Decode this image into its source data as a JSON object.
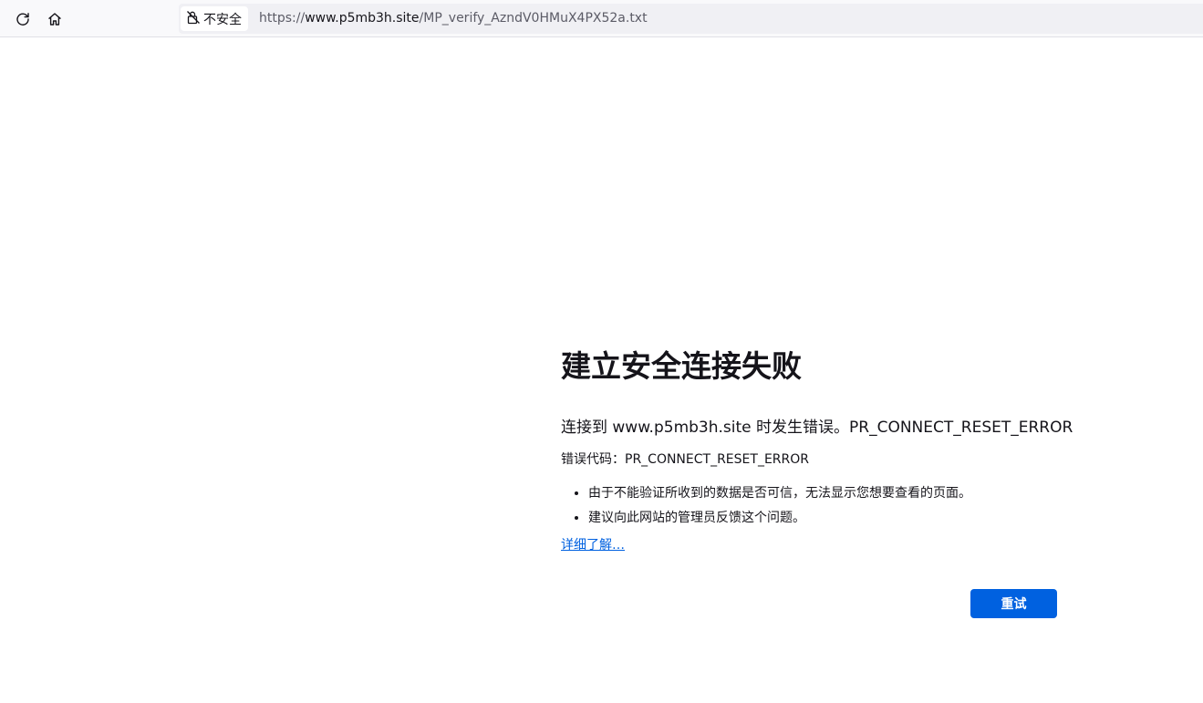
{
  "toolbar": {
    "reload_icon": "reload-icon",
    "home_icon": "home-icon"
  },
  "urlbar": {
    "security_icon": "lock-warning-icon",
    "security_label": "不安全",
    "url_scheme": "https://",
    "url_host": "www.p5mb3h.site",
    "url_path": "/MP_verify_AzndV0HMuX4PX52a.txt"
  },
  "error": {
    "title": "建立安全连接失败",
    "description": "连接到 www.p5mb3h.site 时发生错误。PR_CONNECT_RESET_ERROR",
    "code_line": "错误代码：PR_CONNECT_RESET_ERROR",
    "bullets": [
      "由于不能验证所收到的数据是否可信，无法显示您想要查看的页面。",
      "建议向此网站的管理员反馈这个问题。"
    ],
    "learn_more": "详细了解…",
    "retry_label": "重试"
  },
  "colors": {
    "accent": "#0061e0",
    "text": "#15141a",
    "toolbar_bg": "#f9f9fb",
    "urlbar_bg": "#f0f0f4"
  }
}
